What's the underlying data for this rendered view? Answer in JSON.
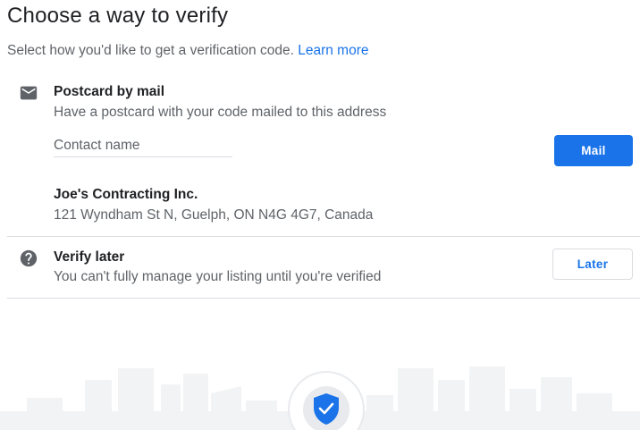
{
  "header": {
    "title": "Choose a way to verify",
    "subtitle": "Select how you'd like to get a verification code.",
    "learn_more": "Learn more"
  },
  "postcard": {
    "icon": "mail-icon",
    "title": "Postcard by mail",
    "description": "Have a postcard with your code mailed to this address",
    "contact_placeholder": "Contact name",
    "contact_value": "",
    "button_label": "Mail",
    "business_name": "Joe's Contracting Inc.",
    "address": "121 Wyndham St N, Guelph, ON N4G 4G7, Canada"
  },
  "later": {
    "icon": "help-icon",
    "title": "Verify later",
    "description": "You can't fully manage your listing until you're verified",
    "button_label": "Later"
  },
  "colors": {
    "accent": "#1a73e8",
    "text_primary": "#202124",
    "text_secondary": "#5f6368",
    "divider": "#dadce0",
    "illustration": "#f1f3f4"
  }
}
